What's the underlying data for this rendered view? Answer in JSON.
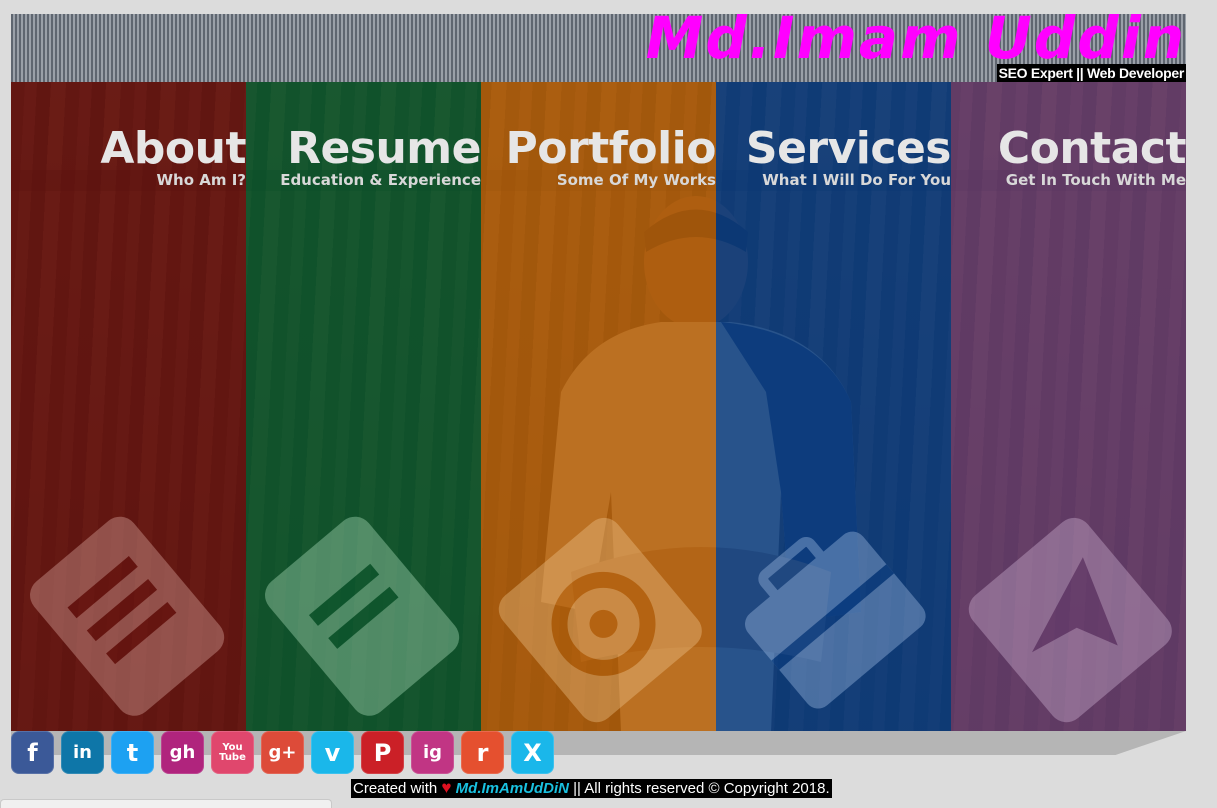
{
  "brand": {
    "name": "Md.Imam Uddin",
    "tagline": "SEO Expert || Web Developer"
  },
  "sections": [
    {
      "title": "About",
      "subtitle": "Who Am I?",
      "color": "#6b1410",
      "icon": "document-icon"
    },
    {
      "title": "Resume",
      "subtitle": "Education & Experience",
      "color": "#0c5a2f",
      "icon": "resume-icon"
    },
    {
      "title": "Portfolio",
      "subtitle": "Some Of My Works",
      "color": "#b7620b",
      "icon": "camera-icon"
    },
    {
      "title": "Services",
      "subtitle": "What I Will Do For You",
      "color": "#0b3f86",
      "icon": "briefcase-icon"
    },
    {
      "title": "Contact",
      "subtitle": "Get In Touch With Me",
      "color": "#6a3f72",
      "icon": "send-icon"
    }
  ],
  "social": [
    {
      "label": "f",
      "name": "facebook-icon",
      "color": "#3b5998"
    },
    {
      "label": "in",
      "name": "linkedin-icon",
      "color": "#0e76a8"
    },
    {
      "label": "t",
      "name": "twitter-icon",
      "color": "#1da1f2"
    },
    {
      "label": "gh",
      "name": "github-icon",
      "color": "#b0247d"
    },
    {
      "label": "You Tube",
      "name": "youtube-icon",
      "color": "#e0476d"
    },
    {
      "label": "g+",
      "name": "google-plus-icon",
      "color": "#dd4b39"
    },
    {
      "label": "v",
      "name": "vimeo-icon",
      "color": "#1ab7ea"
    },
    {
      "label": "P",
      "name": "pinterest-icon",
      "color": "#cb2027"
    },
    {
      "label": "ig",
      "name": "instagram-icon",
      "color": "#c13584"
    },
    {
      "label": "r",
      "name": "reddit-icon",
      "color": "#e5502f"
    },
    {
      "label": "X",
      "name": "xing-icon",
      "color": "#1ab7ea"
    }
  ],
  "footer": {
    "prefix": "Created with",
    "heart": "♥",
    "name": "Md.ImAmUdDiN",
    "suffix": "|| All rights reserved © Copyright 2018."
  }
}
